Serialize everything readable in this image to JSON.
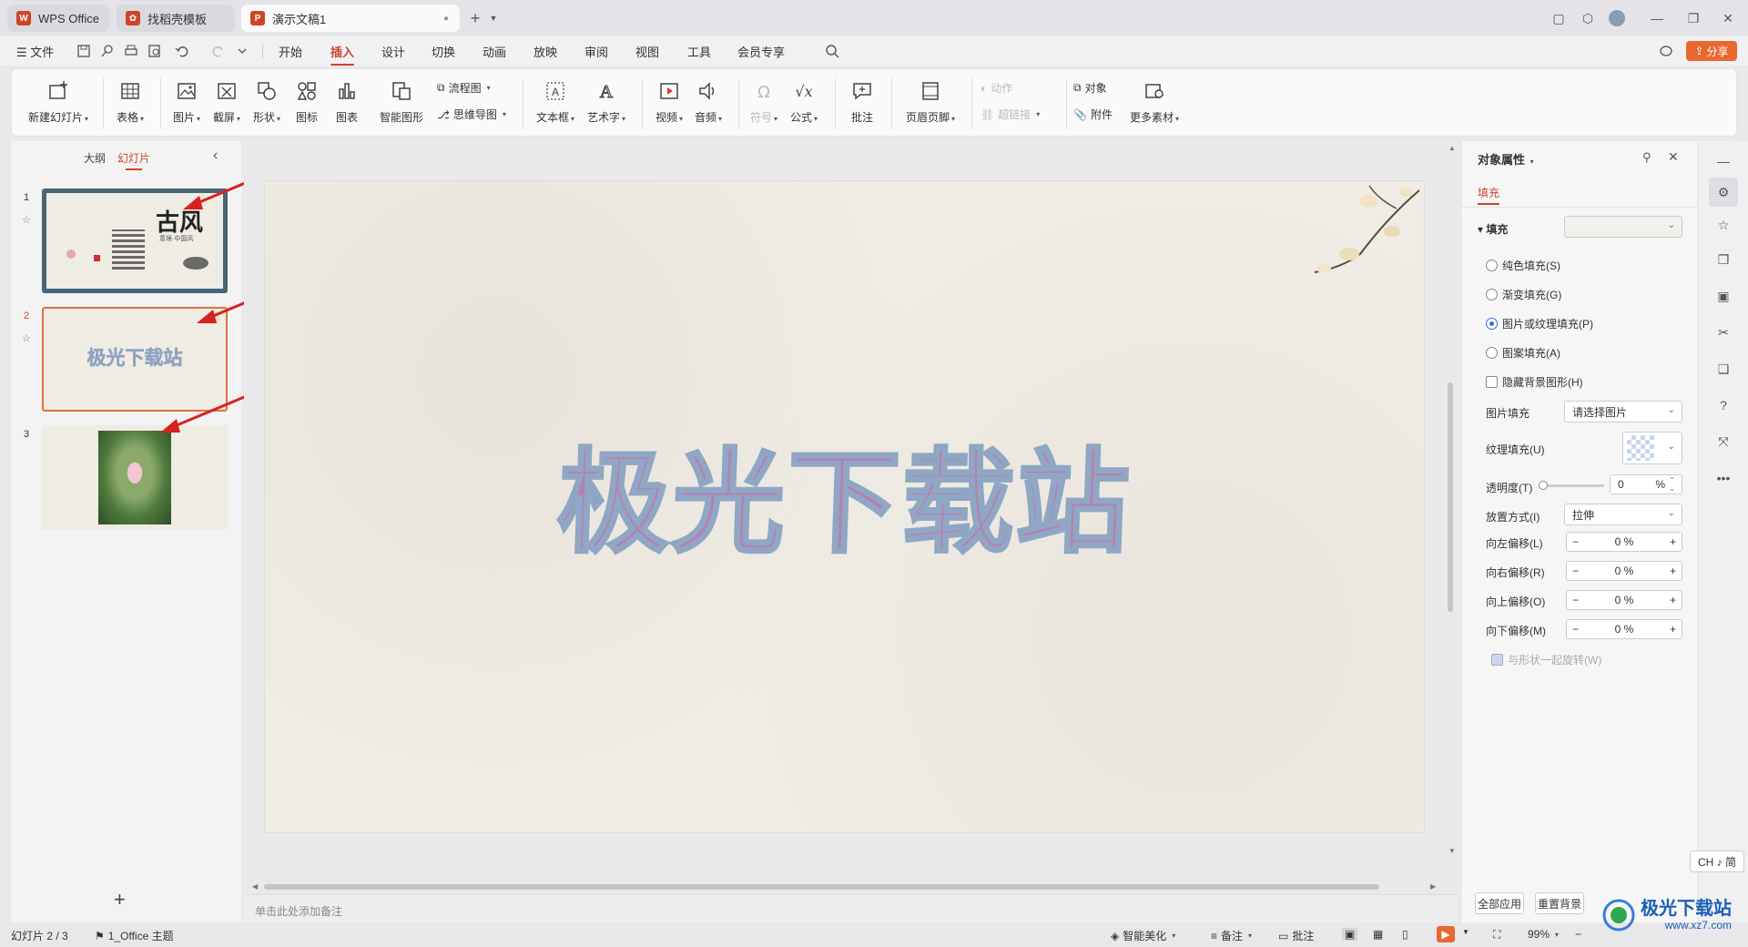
{
  "window": {
    "tabs": [
      {
        "label": "WPS Office",
        "logo": "W",
        "logo_color": "#d0432b"
      },
      {
        "label": "找稻壳模板",
        "logo": "D",
        "logo_color": "#d0432b"
      },
      {
        "label": "演示文稿1",
        "logo": "P",
        "logo_color": "#d0432b"
      }
    ],
    "new_tab": "+"
  },
  "menu": {
    "file": "文件",
    "items": [
      "开始",
      "插入",
      "设计",
      "切换",
      "动画",
      "放映",
      "审阅",
      "视图",
      "工具",
      "会员专享"
    ],
    "active": "插入",
    "share": "分享"
  },
  "ribbon": {
    "new_slide": "新建幻灯片",
    "table": "表格",
    "picture": "图片",
    "screenshot": "截屏",
    "shape": "形状",
    "icon": "图标",
    "chart": "图表",
    "smart_graphic": "智能图形",
    "flowchart": "流程图",
    "mindmap": "思维导图",
    "textbox": "文本框",
    "art_text": "艺术字",
    "video": "视频",
    "audio": "音频",
    "symbol": "符号",
    "formula": "公式",
    "comment": "批注",
    "header_footer": "页眉页脚",
    "action": "动作",
    "hyperlink": "超链接",
    "object": "对象",
    "attachment": "附件",
    "more_material": "更多素材"
  },
  "left_panel": {
    "tab_outline": "大纲",
    "tab_slides": "幻灯片",
    "slides": [
      {
        "number": "1",
        "title": "古风",
        "subtitle": "意境·中国风"
      },
      {
        "number": "2",
        "title": "极光下载站"
      },
      {
        "number": "3",
        "title": ""
      }
    ],
    "add": "+"
  },
  "slide": {
    "main_text": "极光下载站"
  },
  "notes_placeholder": "单击此处添加备注",
  "right_panel": {
    "title": "对象属性",
    "tab_fill": "填充",
    "section_fill": "填充",
    "fill_options": [
      {
        "label": "纯色填充(S)",
        "checked": false
      },
      {
        "label": "渐变填充(G)",
        "checked": false
      },
      {
        "label": "图片或纹理填充(P)",
        "checked": true
      },
      {
        "label": "图案填充(A)",
        "checked": false
      }
    ],
    "hide_bg_graphics": "隐藏背景图形(H)",
    "picture_fill_label": "图片填充",
    "picture_fill_value": "请选择图片",
    "texture_fill_label": "纹理填充(U)",
    "transparency_label": "透明度(T)",
    "transparency_value": "0",
    "percent": "%",
    "placement_label": "放置方式(I)",
    "placement_value": "拉伸",
    "offsets": [
      {
        "label": "向左偏移(L)",
        "value": "0 %"
      },
      {
        "label": "向右偏移(R)",
        "value": "0 %"
      },
      {
        "label": "向上偏移(O)",
        "value": "0 %"
      },
      {
        "label": "向下偏移(M)",
        "value": "0 %"
      }
    ],
    "rotate_with_shape": "与形状一起旋转(W)",
    "apply_all": "全部应用",
    "reset_bg": "重置背景"
  },
  "ime": "CH ♪ 简",
  "status": {
    "slide_count": "幻灯片 2 / 3",
    "theme": "1_Office 主题",
    "smart_beautify": "智能美化",
    "notes": "备注",
    "comments": "批注",
    "zoom": "99%"
  },
  "watermark": {
    "text": "极光下载站",
    "url": "www.xz7.com"
  },
  "colors": {
    "accent": "#d0432b",
    "wordart_fill": "#b77fb0",
    "wordart_stroke": "#8fa6c4"
  }
}
